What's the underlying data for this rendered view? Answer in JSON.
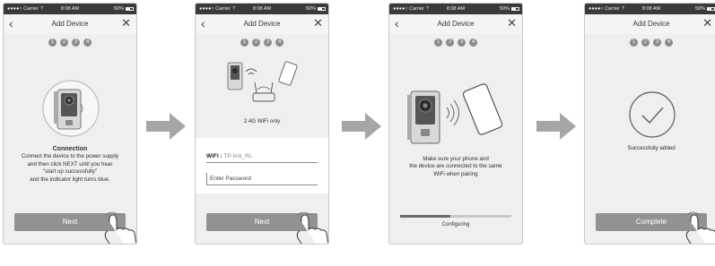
{
  "screens": [
    {
      "status": {
        "carrier": "●●●●○ Carrier ⇡",
        "time": "8:08 AM",
        "battery": "50%"
      },
      "title": "Add Device",
      "steps": [
        "1",
        "2",
        "3",
        "4"
      ],
      "message_title": "Connection",
      "message_lines": [
        "Connect the device to the power supply",
        "and then click NEXT until you hear",
        "\"start up successfully\"",
        "and the indicator light turns blue."
      ],
      "button": "Next"
    },
    {
      "status": {
        "carrier": "●●●●○ Carrier ⇡",
        "time": "8:08 AM",
        "battery": "50%"
      },
      "title": "Add Device",
      "steps": [
        "1",
        "2",
        "3",
        "4"
      ],
      "wifi_caption": "2.4G WiFi only",
      "wifi_label": "WiFi :",
      "wifi_value": "TP-link_RL",
      "password_placeholder": "Enter Password",
      "button": "Next"
    },
    {
      "status": {
        "carrier": "●●●●○ Carrier ⇡",
        "time": "8:08 AM",
        "battery": "50%"
      },
      "title": "Add Device",
      "steps": [
        "1",
        "2",
        "3",
        "4"
      ],
      "message_lines": [
        "Make sure your phone and",
        "the device are connected to the same",
        "WiFi when pairing"
      ],
      "progress": 0.45,
      "progress_label": "Configuring"
    },
    {
      "status": {
        "carrier": "●●●●○ Carrier ⇡",
        "time": "8:08 AM",
        "battery": "50%"
      },
      "title": "Add Device",
      "steps": [
        "1",
        "2",
        "3",
        "4"
      ],
      "success_text": "Successfully added",
      "button": "Complete"
    }
  ],
  "colors": {
    "button": "#929292",
    "screen_bg": "#efefef",
    "status_bar": "#3a3a3a",
    "arrow": "#a6a6a6"
  }
}
